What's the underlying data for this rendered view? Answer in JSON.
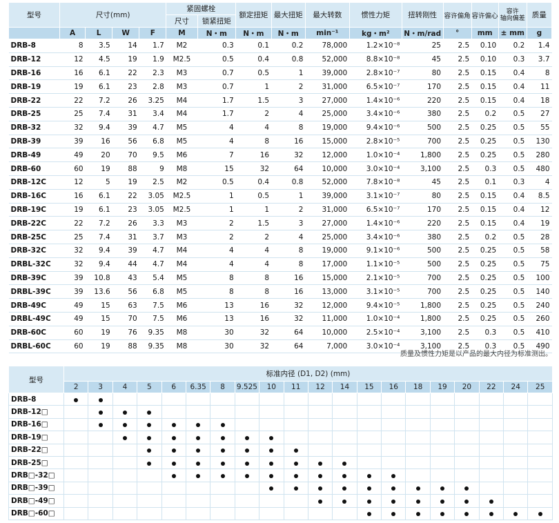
{
  "spec_table": {
    "headers": {
      "model": "型号",
      "dimensions": "尺寸(mm)",
      "screw": "紧固螺栓",
      "screw_size": "尺寸",
      "screw_torque": "锁紧扭矩",
      "rated_torque": "额定扭矩",
      "max_torque": "最大扭矩",
      "max_speed": "最大转数",
      "inertia": "惯性力矩",
      "stiffness": "扭转刚性",
      "angular": "容许偏角",
      "parallel": "容许偏心",
      "axial_line1": "容许",
      "axial_line2": "轴向偏差",
      "mass": "质量"
    },
    "units": [
      "A",
      "L",
      "W",
      "F",
      "M",
      "N・m",
      "N・m",
      "N・m",
      "min⁻¹",
      "kg・m²",
      "N・m/rad",
      "°",
      "mm",
      "± mm",
      "g"
    ],
    "rows": [
      [
        "DRB-8",
        "8",
        "3.5",
        "14",
        "1.7",
        "M2",
        "0.3",
        "0.1",
        "0.2",
        "78,000",
        "1.2×10⁻⁸",
        "25",
        "2.5",
        "0.10",
        "0.2",
        "1.4"
      ],
      [
        "DRB-12",
        "12",
        "4.5",
        "19",
        "1.9",
        "M2.5",
        "0.5",
        "0.4",
        "0.8",
        "52,000",
        "8.8×10⁻⁸",
        "45",
        "2.5",
        "0.10",
        "0.3",
        "3.7"
      ],
      [
        "DRB-16",
        "16",
        "6.1",
        "22",
        "2.3",
        "M3",
        "0.7",
        "0.5",
        "1",
        "39,000",
        "2.8×10⁻⁷",
        "80",
        "2.5",
        "0.15",
        "0.4",
        "8"
      ],
      [
        "DRB-19",
        "19",
        "6.1",
        "23",
        "2.8",
        "M3",
        "0.7",
        "1",
        "2",
        "31,000",
        "6.5×10⁻⁷",
        "170",
        "2.5",
        "0.15",
        "0.4",
        "11"
      ],
      [
        "DRB-22",
        "22",
        "7.2",
        "26",
        "3.25",
        "M4",
        "1.7",
        "1.5",
        "3",
        "27,000",
        "1.4×10⁻⁶",
        "220",
        "2.5",
        "0.15",
        "0.4",
        "18"
      ],
      [
        "DRB-25",
        "25",
        "7.4",
        "31",
        "3.4",
        "M4",
        "1.7",
        "2",
        "4",
        "25,000",
        "3.4×10⁻⁶",
        "380",
        "2.5",
        "0.2",
        "0.5",
        "27"
      ],
      [
        "DRB-32",
        "32",
        "9.4",
        "39",
        "4.7",
        "M5",
        "4",
        "4",
        "8",
        "19,000",
        "9.4×10⁻⁶",
        "500",
        "2.5",
        "0.25",
        "0.5",
        "55"
      ],
      [
        "DRB-39",
        "39",
        "16",
        "56",
        "6.8",
        "M5",
        "4",
        "8",
        "16",
        "15,000",
        "2.8×10⁻⁵",
        "700",
        "2.5",
        "0.25",
        "0.5",
        "130"
      ],
      [
        "DRB-49",
        "49",
        "20",
        "70",
        "9.5",
        "M6",
        "7",
        "16",
        "32",
        "12,000",
        "1.0×10⁻⁴",
        "1,800",
        "2.5",
        "0.25",
        "0.5",
        "280"
      ],
      [
        "DRB-60",
        "60",
        "19",
        "88",
        "9",
        "M8",
        "15",
        "32",
        "64",
        "10,000",
        "3.0×10⁻⁴",
        "3,100",
        "2.5",
        "0.3",
        "0.5",
        "480"
      ],
      [
        "DRB-12C",
        "12",
        "5",
        "19",
        "2.5",
        "M2",
        "0.5",
        "0.4",
        "0.8",
        "52,000",
        "7.8×10⁻⁸",
        "45",
        "2.5",
        "0.1",
        "0.3",
        "4"
      ],
      [
        "DRB-16C",
        "16",
        "6.1",
        "22",
        "3.05",
        "M2.5",
        "1",
        "0.5",
        "1",
        "39,000",
        "3.1×10⁻⁷",
        "80",
        "2.5",
        "0.15",
        "0.4",
        "8.5"
      ],
      [
        "DRB-19C",
        "19",
        "6.1",
        "23",
        "3.05",
        "M2.5",
        "1",
        "1",
        "2",
        "31,000",
        "6.5×10⁻⁷",
        "170",
        "2.5",
        "0.15",
        "0.4",
        "12"
      ],
      [
        "DRB-22C",
        "22",
        "7.2",
        "26",
        "3.3",
        "M3",
        "2",
        "1.5",
        "3",
        "27,000",
        "1.4×10⁻⁶",
        "220",
        "2.5",
        "0.15",
        "0.4",
        "19"
      ],
      [
        "DRB-25C",
        "25",
        "7.4",
        "31",
        "3.7",
        "M3",
        "2",
        "2",
        "4",
        "25,000",
        "3.4×10⁻⁶",
        "380",
        "2.5",
        "0.2",
        "0.5",
        "28"
      ],
      [
        "DRB-32C",
        "32",
        "9.4",
        "39",
        "4.7",
        "M4",
        "4",
        "4",
        "8",
        "19,000",
        "9.1×10⁻⁶",
        "500",
        "2.5",
        "0.25",
        "0.5",
        "58"
      ],
      [
        "DRBL-32C",
        "32",
        "9.4",
        "44",
        "4.7",
        "M4",
        "4",
        "4",
        "8",
        "17,000",
        "1.1×10⁻⁵",
        "500",
        "2.5",
        "0.25",
        "0.5",
        "75"
      ],
      [
        "DRB-39C",
        "39",
        "10.8",
        "43",
        "5.4",
        "M5",
        "8",
        "8",
        "16",
        "15,000",
        "2.1×10⁻⁵",
        "700",
        "2.5",
        "0.25",
        "0.5",
        "100"
      ],
      [
        "DRBL-39C",
        "39",
        "13.6",
        "56",
        "6.8",
        "M5",
        "8",
        "8",
        "16",
        "13,000",
        "3.1×10⁻⁵",
        "700",
        "2.5",
        "0.25",
        "0.5",
        "140"
      ],
      [
        "DRB-49C",
        "49",
        "15",
        "63",
        "7.5",
        "M6",
        "13",
        "16",
        "32",
        "12,000",
        "9.4×10⁻⁵",
        "1,800",
        "2.5",
        "0.25",
        "0.5",
        "240"
      ],
      [
        "DRBL-49C",
        "49",
        "15",
        "70",
        "7.5",
        "M6",
        "13",
        "16",
        "32",
        "11,000",
        "1.0×10⁻⁴",
        "1,800",
        "2.5",
        "0.25",
        "0.5",
        "260"
      ],
      [
        "DRB-60C",
        "60",
        "19",
        "76",
        "9.35",
        "M8",
        "30",
        "32",
        "64",
        "10,000",
        "2.5×10⁻⁴",
        "3,100",
        "2.5",
        "0.3",
        "0.5",
        "410"
      ],
      [
        "DRBL-60C",
        "60",
        "19",
        "88",
        "9.35",
        "M8",
        "30",
        "32",
        "64",
        "7,000",
        "3.0×10⁻⁴",
        "3,100",
        "2.5",
        "0.3",
        "0.5",
        "490"
      ]
    ]
  },
  "note": "质量及惯性力矩是以产品的最大内径为标准测出。",
  "bore_table": {
    "model_header": "型号",
    "title": "标准内径 (D1, D2) (mm)",
    "diameters": [
      "2",
      "3",
      "4",
      "5",
      "6",
      "6.35",
      "8",
      "9.525",
      "10",
      "11",
      "12",
      "14",
      "15",
      "16",
      "18",
      "19",
      "20",
      "22",
      "24",
      "25"
    ],
    "rows": [
      {
        "model": "DRB-8",
        "marks": [
          1,
          1,
          0,
          0,
          0,
          0,
          0,
          0,
          0,
          0,
          0,
          0,
          0,
          0,
          0,
          0,
          0,
          0,
          0,
          0
        ]
      },
      {
        "model": "DRB-12□",
        "marks": [
          0,
          1,
          1,
          1,
          0,
          0,
          0,
          0,
          0,
          0,
          0,
          0,
          0,
          0,
          0,
          0,
          0,
          0,
          0,
          0
        ]
      },
      {
        "model": "DRB-16□",
        "marks": [
          0,
          1,
          1,
          1,
          1,
          1,
          1,
          0,
          0,
          0,
          0,
          0,
          0,
          0,
          0,
          0,
          0,
          0,
          0,
          0
        ]
      },
      {
        "model": "DRB-19□",
        "marks": [
          0,
          0,
          1,
          1,
          1,
          1,
          1,
          1,
          1,
          0,
          0,
          0,
          0,
          0,
          0,
          0,
          0,
          0,
          0,
          0
        ]
      },
      {
        "model": "DRB-22□",
        "marks": [
          0,
          0,
          0,
          1,
          1,
          1,
          1,
          1,
          1,
          1,
          0,
          0,
          0,
          0,
          0,
          0,
          0,
          0,
          0,
          0
        ]
      },
      {
        "model": "DRB-25□",
        "marks": [
          0,
          0,
          0,
          1,
          1,
          1,
          1,
          1,
          1,
          1,
          1,
          1,
          0,
          0,
          0,
          0,
          0,
          0,
          0,
          0
        ]
      },
      {
        "model": "DRB□-32□",
        "marks": [
          0,
          0,
          0,
          0,
          1,
          1,
          1,
          1,
          1,
          1,
          1,
          1,
          1,
          1,
          0,
          0,
          0,
          0,
          0,
          0
        ]
      },
      {
        "model": "DRB□-39□",
        "marks": [
          0,
          0,
          0,
          0,
          0,
          0,
          0,
          0,
          1,
          1,
          1,
          1,
          1,
          1,
          1,
          1,
          1,
          0,
          0,
          0
        ]
      },
      {
        "model": "DRB□-49□",
        "marks": [
          0,
          0,
          0,
          0,
          0,
          0,
          0,
          0,
          0,
          0,
          1,
          1,
          1,
          1,
          1,
          1,
          1,
          1,
          0,
          0
        ]
      },
      {
        "model": "DRB□-60□",
        "marks": [
          0,
          0,
          0,
          0,
          0,
          0,
          0,
          0,
          0,
          0,
          0,
          0,
          1,
          1,
          1,
          1,
          1,
          1,
          1,
          1
        ]
      }
    ]
  }
}
